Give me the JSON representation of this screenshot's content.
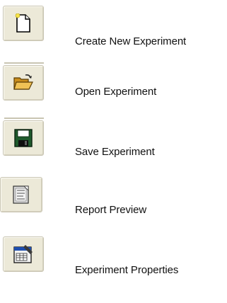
{
  "toolbar": {
    "items": [
      {
        "label": "Create New Experiment",
        "icon": "new-document-icon"
      },
      {
        "label": "Open Experiment",
        "icon": "open-folder-icon"
      },
      {
        "label": "Save Experiment",
        "icon": "floppy-disk-icon"
      },
      {
        "label": "Report Preview",
        "icon": "report-preview-icon"
      },
      {
        "label": "Experiment Properties",
        "icon": "properties-icon"
      }
    ]
  },
  "colors": {
    "button_face": "#ece9d8",
    "button_border": "#c9c5b2",
    "folder": "#e8b84a",
    "floppy": "#1f5a2c",
    "properties_accent": "#1f4fb0"
  }
}
